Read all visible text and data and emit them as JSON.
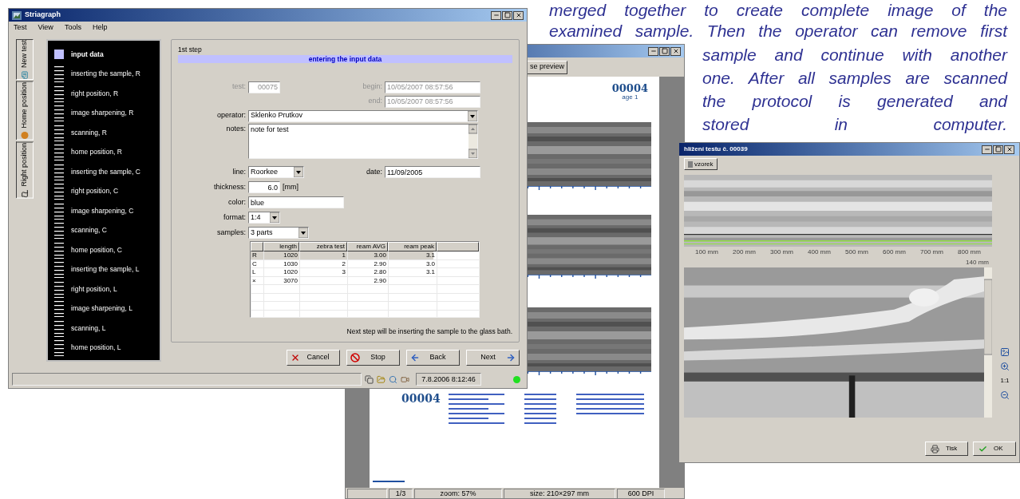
{
  "caption_top": [
    "merged together to create complete image of the",
    "examined sample. Then the operator can remove first"
  ],
  "caption_bottom": [
    "sample and continue with another",
    "one. After all samples are scanned",
    "the protocol is generated and",
    "stored in computer."
  ],
  "main_window": {
    "title": "Striagraph",
    "menu": [
      "Test",
      "View",
      "Tools",
      "Help"
    ],
    "side_tabs": [
      {
        "label": "New test",
        "kind": "new"
      },
      {
        "label": "Home position",
        "kind": "home"
      },
      {
        "label": "Right position",
        "kind": "right"
      }
    ],
    "steps": [
      {
        "label": "input data",
        "selected": true
      },
      {
        "label": "inserting the sample, R",
        "selected": false
      },
      {
        "label": "right position, R",
        "selected": false
      },
      {
        "label": "image sharpening, R",
        "selected": false
      },
      {
        "label": "scanning, R",
        "selected": false
      },
      {
        "label": "home position, R",
        "selected": false
      },
      {
        "label": "inserting the sample, C",
        "selected": false
      },
      {
        "label": "right position, C",
        "selected": false
      },
      {
        "label": "image sharpening, C",
        "selected": false
      },
      {
        "label": "scanning, C",
        "selected": false
      },
      {
        "label": "home position, C",
        "selected": false
      },
      {
        "label": "inserting the sample, L",
        "selected": false
      },
      {
        "label": "right position, L",
        "selected": false
      },
      {
        "label": "image sharpening, L",
        "selected": false
      },
      {
        "label": "scanning, L",
        "selected": false
      },
      {
        "label": "home position, L",
        "selected": false
      }
    ],
    "form": {
      "step": "1st step",
      "heading": "entering the input data",
      "test": {
        "label": "test:",
        "value": "00075",
        "disabled": true
      },
      "begin": {
        "label": "begin:",
        "value": "10/05/2007 08:57:56",
        "disabled": true
      },
      "end": {
        "label": "end:",
        "value": "10/05/2007 08:57:56",
        "disabled": true
      },
      "operator": {
        "label": "operator:",
        "value": "Sklenko Prutkov"
      },
      "notes": {
        "label": "notes:",
        "value": "note for test"
      },
      "line": {
        "label": "line:",
        "value": "Roorkee"
      },
      "date": {
        "label": "date:",
        "value": "11/09/2005"
      },
      "thickness": {
        "label": "thickness:",
        "value": "6.0",
        "unit": "[mm]"
      },
      "color": {
        "label": "color:",
        "value": "blue"
      },
      "format": {
        "label": "format:",
        "value": "1:4"
      },
      "samples": {
        "label": "samples:",
        "value": "3 parts"
      }
    },
    "table": {
      "columns": [
        "length",
        "zebra test",
        "ream AVG",
        "ream peak"
      ],
      "rows": [
        {
          "key": "R",
          "cells": [
            "1020",
            "1",
            "3.00",
            "3.1"
          ],
          "selected": true
        },
        {
          "key": "C",
          "cells": [
            "1030",
            "2",
            "2.90",
            "3.0"
          ],
          "selected": false
        },
        {
          "key": "L",
          "cells": [
            "1020",
            "3",
            "2.80",
            "3.1"
          ],
          "selected": false
        },
        {
          "key": "×",
          "cells": [
            "3070",
            null,
            "2.90",
            null
          ],
          "selected": false
        }
      ]
    },
    "note": "Next step will be inserting the sample to the glass bath.",
    "buttons": [
      {
        "label": "Cancel",
        "kind": "cancel"
      },
      {
        "label": "Stop",
        "kind": "stop"
      },
      {
        "label": "Back",
        "kind": "back"
      },
      {
        "label": "Next",
        "kind": "next"
      }
    ],
    "status_bar": {
      "time": "7.8.2006 8:12:46",
      "online": true
    }
  },
  "preview_window": {
    "close_button": "se preview",
    "page_number": "00004",
    "page_label": "age 1",
    "summary_number": "00004",
    "status_bar": [
      "1/3",
      "zoom: 57%",
      "size: 210×297 mm",
      "600 DPI"
    ]
  },
  "scan_window": {
    "title": "hlížení testu č. 00039",
    "tab": "vzorek",
    "ruler": [
      "100 mm",
      "200 mm",
      "300 mm",
      "400 mm",
      "500 mm",
      "600 mm",
      "700 mm",
      "800 mm"
    ],
    "depth_label": "140 mm",
    "zoom_label": "1:1",
    "buttons": [
      {
        "label": "Tisk",
        "kind": "print"
      },
      {
        "label": "OK",
        "kind": "ok"
      }
    ]
  }
}
